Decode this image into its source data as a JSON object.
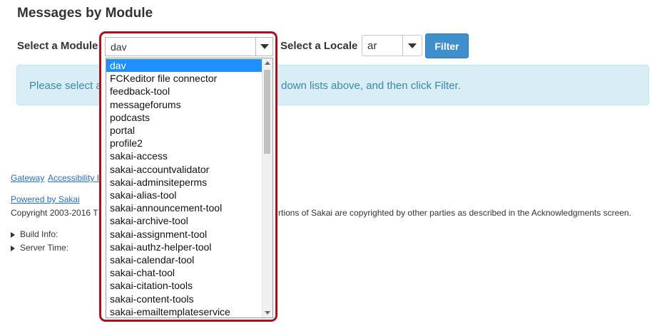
{
  "page": {
    "title": "Messages by Module"
  },
  "form": {
    "module_label": "Select a Module",
    "module_value": "dav",
    "locale_label": "Select a Locale",
    "locale_value": "ar",
    "filter_label": "Filter"
  },
  "info": {
    "text_start": "Please select a",
    "text_end": "down lists above, and then click Filter."
  },
  "dropdown": {
    "options": [
      "dav",
      "FCKeditor file connector",
      "feedback-tool",
      "messageforums",
      "podcasts",
      "portal",
      "profile2",
      "sakai-access",
      "sakai-accountvalidator",
      "sakai-adminsiteperms",
      "sakai-alias-tool",
      "sakai-announcement-tool",
      "sakai-archive-tool",
      "sakai-assignment-tool",
      "sakai-authz-helper-tool",
      "sakai-calendar-tool",
      "sakai-chat-tool",
      "sakai-citation-tools",
      "sakai-content-tools",
      "sakai-emailtemplateservice"
    ],
    "selected_index": 0
  },
  "footer": {
    "gateway": "Gateway",
    "accessibility": "Accessibility I",
    "powered_by": "Powered by Sakai",
    "copyright_start": "Copyright 2003-2016 T",
    "copyright_end": "rtions of Sakai are copyrighted by other parties as described in the Acknowledgments screen.",
    "build_info": "Build Info:",
    "server_time": "Server Time:"
  }
}
